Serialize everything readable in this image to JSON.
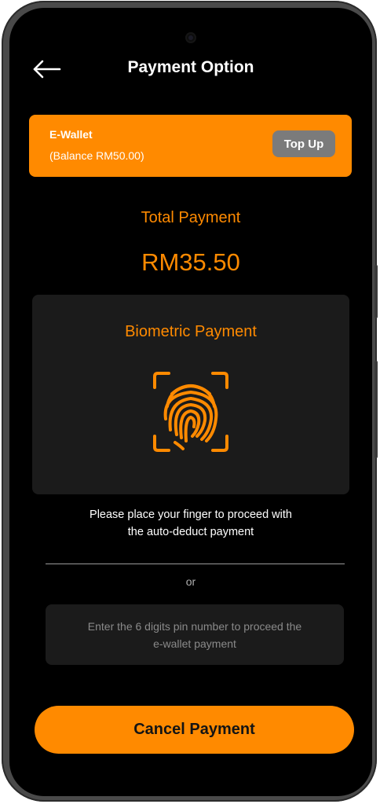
{
  "header": {
    "title": "Payment Option",
    "back_icon": "arrow-left-icon"
  },
  "wallet": {
    "title": "E-Wallet",
    "balance": "(Balance RM50.00)",
    "topup_label": "Top Up"
  },
  "payment": {
    "total_label": "Total Payment",
    "total_amount": "RM35.50"
  },
  "biometric": {
    "title": "Biometric Payment",
    "icon": "fingerprint-scan-icon",
    "instruction_line1": "Please place your finger to proceed  with",
    "instruction_line2": "the auto-deduct payment"
  },
  "separator_text": "or",
  "pin_input": {
    "placeholder_line1": "Enter the 6 digits pin number to proceed the",
    "placeholder_line2": "e-wallet payment"
  },
  "cancel_label": "Cancel Payment",
  "colors": {
    "accent": "#ff8a00",
    "background": "#000000",
    "card": "#1b1b1b",
    "topup_button": "#7b7b7b"
  }
}
